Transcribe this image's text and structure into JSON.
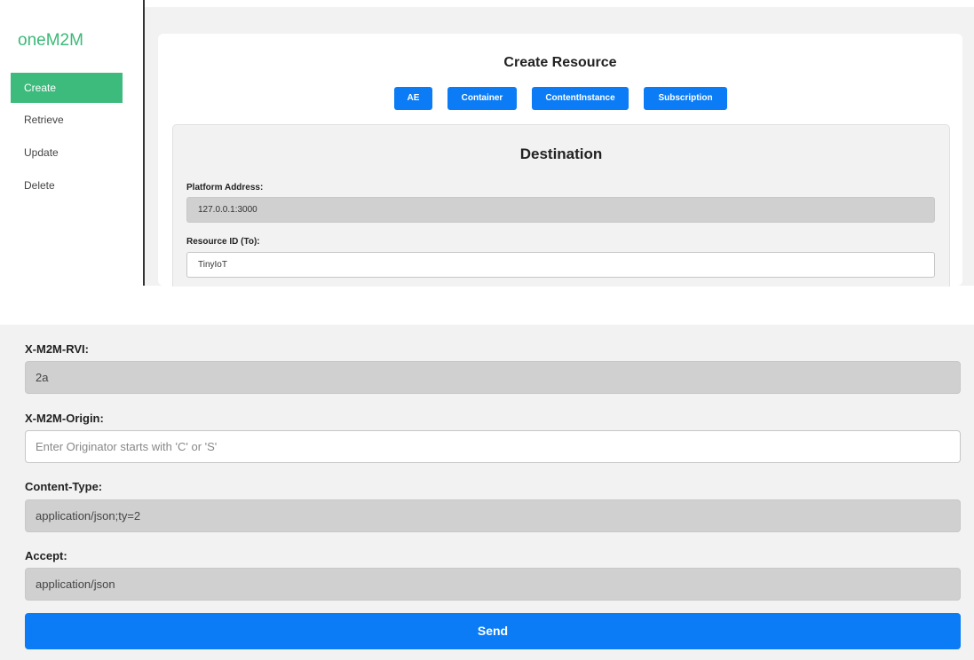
{
  "sidebar": {
    "brand": "oneM2M",
    "items": [
      {
        "label": "Create",
        "active": true
      },
      {
        "label": "Retrieve",
        "active": false
      },
      {
        "label": "Update",
        "active": false
      },
      {
        "label": "Delete",
        "active": false
      }
    ]
  },
  "card": {
    "title": "Create Resource",
    "types": [
      "AE",
      "Container",
      "ContentInstance",
      "Subscription"
    ]
  },
  "destination": {
    "title": "Destination",
    "platform_label": "Platform Address:",
    "platform_value": "127.0.0.1:3000",
    "resource_label": "Resource ID (To):",
    "resource_value": "TinyIoT"
  },
  "headers": {
    "rvi_label": "X-M2M-RVI:",
    "rvi_value": "2a",
    "origin_label": "X-M2M-Origin:",
    "origin_placeholder": "Enter Originator starts with 'C' or 'S'",
    "content_type_label": "Content-Type:",
    "content_type_value": "application/json;ty=2",
    "accept_label": "Accept:",
    "accept_value": "application/json"
  },
  "send_label": "Send",
  "colors": {
    "brand_green": "#3cb878",
    "active_nav": "#3dbb7d",
    "primary_blue": "#0b7cf5",
    "readonly_field": "#d0d0d0"
  }
}
